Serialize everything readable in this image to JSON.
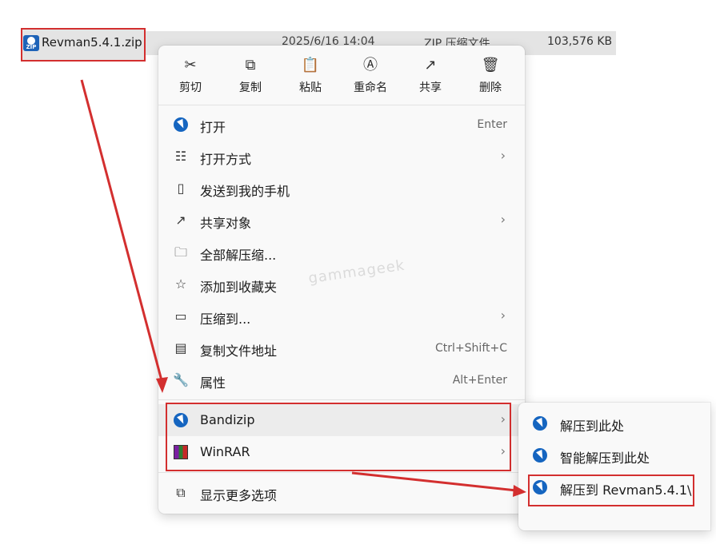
{
  "file": {
    "name": "Revman5.4.1.zip",
    "date": "2025/6/16 14:04",
    "type": "ZIP 压缩文件",
    "size": "103,576 KB",
    "icon": "zip-archive-icon"
  },
  "quick_actions": [
    {
      "label": "剪切",
      "icon": "scissors-icon"
    },
    {
      "label": "复制",
      "icon": "copy-icon"
    },
    {
      "label": "粘贴",
      "icon": "paste-icon"
    },
    {
      "label": "重命名",
      "icon": "rename-icon"
    },
    {
      "label": "共享",
      "icon": "share-icon"
    },
    {
      "label": "删除",
      "icon": "trash-icon"
    }
  ],
  "menu_items": [
    {
      "label": "打开",
      "shortcut": "Enter",
      "icon": "bandizip-icon"
    },
    {
      "label": "打开方式",
      "submenu": true,
      "icon": "open-with-icon"
    },
    {
      "label": "发送到我的手机",
      "icon": "phone-icon"
    },
    {
      "label": "共享对象",
      "submenu": true,
      "icon": "share-icon"
    },
    {
      "label": "全部解压缩...",
      "icon": "extract-folder-icon"
    },
    {
      "label": "添加到收藏夹",
      "icon": "star-icon"
    },
    {
      "label": "压缩到...",
      "submenu": true,
      "icon": "compress-icon"
    },
    {
      "label": "复制文件地址",
      "shortcut": "Ctrl+Shift+C",
      "icon": "copy-path-icon"
    },
    {
      "label": "属性",
      "shortcut": "Alt+Enter",
      "icon": "wrench-icon"
    }
  ],
  "app_items": [
    {
      "label": "Bandizip",
      "icon": "bandizip-icon"
    },
    {
      "label": "WinRAR",
      "icon": "winrar-icon"
    }
  ],
  "more_options": {
    "label": "显示更多选项",
    "icon": "more-options-icon"
  },
  "submenu_items": [
    {
      "label": "解压到此处"
    },
    {
      "label": "智能解压到此处"
    },
    {
      "label": "解压到 Revman5.4.1\\"
    }
  ],
  "watermark": "gammageek",
  "colors": {
    "highlight_red": "#d32f2f",
    "bandizip_blue": "#1565c0"
  }
}
